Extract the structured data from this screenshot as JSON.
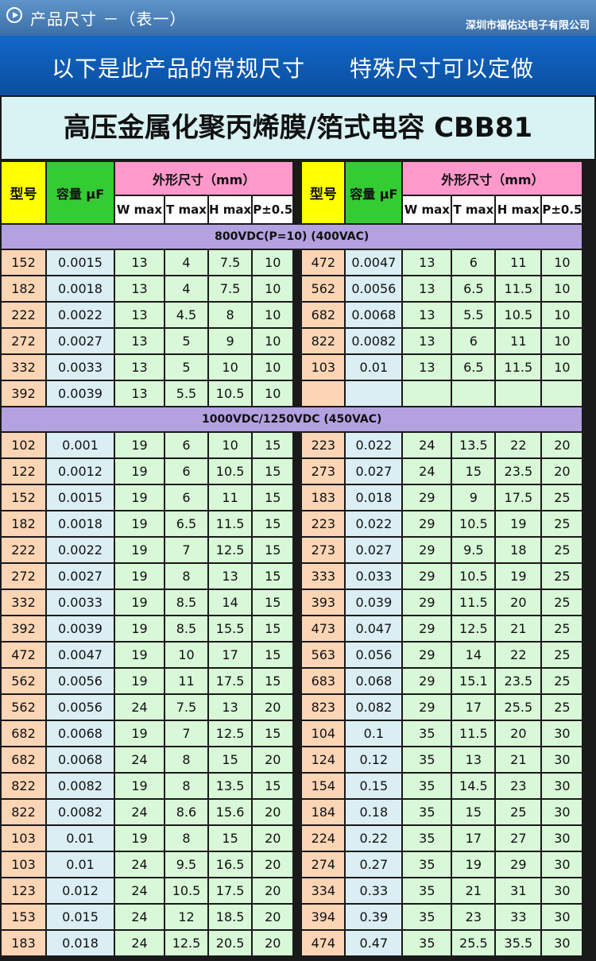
{
  "header": {
    "title": "产品尺寸 －（表一）",
    "company": "深圳市福佑达电子有限公司",
    "play_icon": "play-circle-icon"
  },
  "banner": {
    "left": "以下是此产品的常规尺寸",
    "right": "特殊尺寸可以定做"
  },
  "main_title": "高压金属化聚丙烯膜/箔式电容 CBB81",
  "columns": {
    "model": "型号",
    "capacity": "容量 μF",
    "dimension_group": "外形尺寸（mm）",
    "w": "W max",
    "t": "T max",
    "h": "H max",
    "p": "P±0.5"
  },
  "sections": [
    {
      "label": "800VDC(P=10) (400VAC)",
      "rows": [
        [
          [
            "152",
            "0.0015",
            "13",
            "4",
            "7.5",
            "10"
          ],
          [
            "472",
            "0.0047",
            "13",
            "6",
            "11",
            "10"
          ]
        ],
        [
          [
            "182",
            "0.0018",
            "13",
            "4",
            "7.5",
            "10"
          ],
          [
            "562",
            "0.0056",
            "13",
            "6.5",
            "11.5",
            "10"
          ]
        ],
        [
          [
            "222",
            "0.0022",
            "13",
            "4.5",
            "8",
            "10"
          ],
          [
            "682",
            "0.0068",
            "13",
            "5.5",
            "10.5",
            "10"
          ]
        ],
        [
          [
            "272",
            "0.0027",
            "13",
            "5",
            "9",
            "10"
          ],
          [
            "822",
            "0.0082",
            "13",
            "6",
            "11",
            "10"
          ]
        ],
        [
          [
            "332",
            "0.0033",
            "13",
            "5",
            "10",
            "10"
          ],
          [
            "103",
            "0.01",
            "13",
            "6.5",
            "11.5",
            "10"
          ]
        ],
        [
          [
            "392",
            "0.0039",
            "13",
            "5.5",
            "10.5",
            "10"
          ],
          [
            "",
            "",
            "",
            "",
            "",
            ""
          ]
        ]
      ]
    },
    {
      "label": "1000VDC/1250VDC (450VAC)",
      "rows": [
        [
          [
            "102",
            "0.001",
            "19",
            "6",
            "10",
            "15"
          ],
          [
            "223",
            "0.022",
            "24",
            "13.5",
            "22",
            "20"
          ]
        ],
        [
          [
            "122",
            "0.0012",
            "19",
            "6",
            "10.5",
            "15"
          ],
          [
            "273",
            "0.027",
            "24",
            "15",
            "23.5",
            "20"
          ]
        ],
        [
          [
            "152",
            "0.0015",
            "19",
            "6",
            "11",
            "15"
          ],
          [
            "183",
            "0.018",
            "29",
            "9",
            "17.5",
            "25"
          ]
        ],
        [
          [
            "182",
            "0.0018",
            "19",
            "6.5",
            "11.5",
            "15"
          ],
          [
            "223",
            "0.022",
            "29",
            "10.5",
            "19",
            "25"
          ]
        ],
        [
          [
            "222",
            "0.0022",
            "19",
            "7",
            "12.5",
            "15"
          ],
          [
            "273",
            "0.027",
            "29",
            "9.5",
            "18",
            "25"
          ]
        ],
        [
          [
            "272",
            "0.0027",
            "19",
            "8",
            "13",
            "15"
          ],
          [
            "333",
            "0.033",
            "29",
            "10.5",
            "19",
            "25"
          ]
        ],
        [
          [
            "332",
            "0.0033",
            "19",
            "8.5",
            "14",
            "15"
          ],
          [
            "393",
            "0.039",
            "29",
            "11.5",
            "20",
            "25"
          ]
        ],
        [
          [
            "392",
            "0.0039",
            "19",
            "8.5",
            "15.5",
            "15"
          ],
          [
            "473",
            "0.047",
            "29",
            "12.5",
            "21",
            "25"
          ]
        ],
        [
          [
            "472",
            "0.0047",
            "19",
            "10",
            "17",
            "15"
          ],
          [
            "563",
            "0.056",
            "29",
            "14",
            "22",
            "25"
          ]
        ],
        [
          [
            "562",
            "0.0056",
            "19",
            "11",
            "17.5",
            "15"
          ],
          [
            "683",
            "0.068",
            "29",
            "15.1",
            "23.5",
            "25"
          ]
        ],
        [
          [
            "562",
            "0.0056",
            "24",
            "7.5",
            "13",
            "20"
          ],
          [
            "823",
            "0.082",
            "29",
            "17",
            "25.5",
            "25"
          ]
        ],
        [
          [
            "682",
            "0.0068",
            "19",
            "7",
            "12.5",
            "15"
          ],
          [
            "104",
            "0.1",
            "35",
            "11.5",
            "20",
            "30"
          ]
        ],
        [
          [
            "682",
            "0.0068",
            "24",
            "8",
            "15",
            "20"
          ],
          [
            "124",
            "0.12",
            "35",
            "13",
            "21",
            "30"
          ]
        ],
        [
          [
            "822",
            "0.0082",
            "19",
            "8",
            "13.5",
            "15"
          ],
          [
            "154",
            "0.15",
            "35",
            "14.5",
            "23",
            "30"
          ]
        ],
        [
          [
            "822",
            "0.0082",
            "24",
            "8.6",
            "15.6",
            "20"
          ],
          [
            "184",
            "0.18",
            "35",
            "15",
            "25",
            "30"
          ]
        ],
        [
          [
            "103",
            "0.01",
            "19",
            "8",
            "15",
            "20"
          ],
          [
            "224",
            "0.22",
            "35",
            "17",
            "27",
            "30"
          ]
        ],
        [
          [
            "103",
            "0.01",
            "24",
            "9.5",
            "16.5",
            "20"
          ],
          [
            "274",
            "0.27",
            "35",
            "19",
            "29",
            "30"
          ]
        ],
        [
          [
            "123",
            "0.012",
            "24",
            "10.5",
            "17.5",
            "20"
          ],
          [
            "334",
            "0.33",
            "35",
            "21",
            "31",
            "30"
          ]
        ],
        [
          [
            "153",
            "0.015",
            "24",
            "12",
            "18.5",
            "20"
          ],
          [
            "394",
            "0.39",
            "35",
            "23",
            "33",
            "30"
          ]
        ],
        [
          [
            "183",
            "0.018",
            "24",
            "12.5",
            "20.5",
            "20"
          ],
          [
            "474",
            "0.47",
            "35",
            "25.5",
            "35.5",
            "30"
          ]
        ]
      ]
    }
  ]
}
